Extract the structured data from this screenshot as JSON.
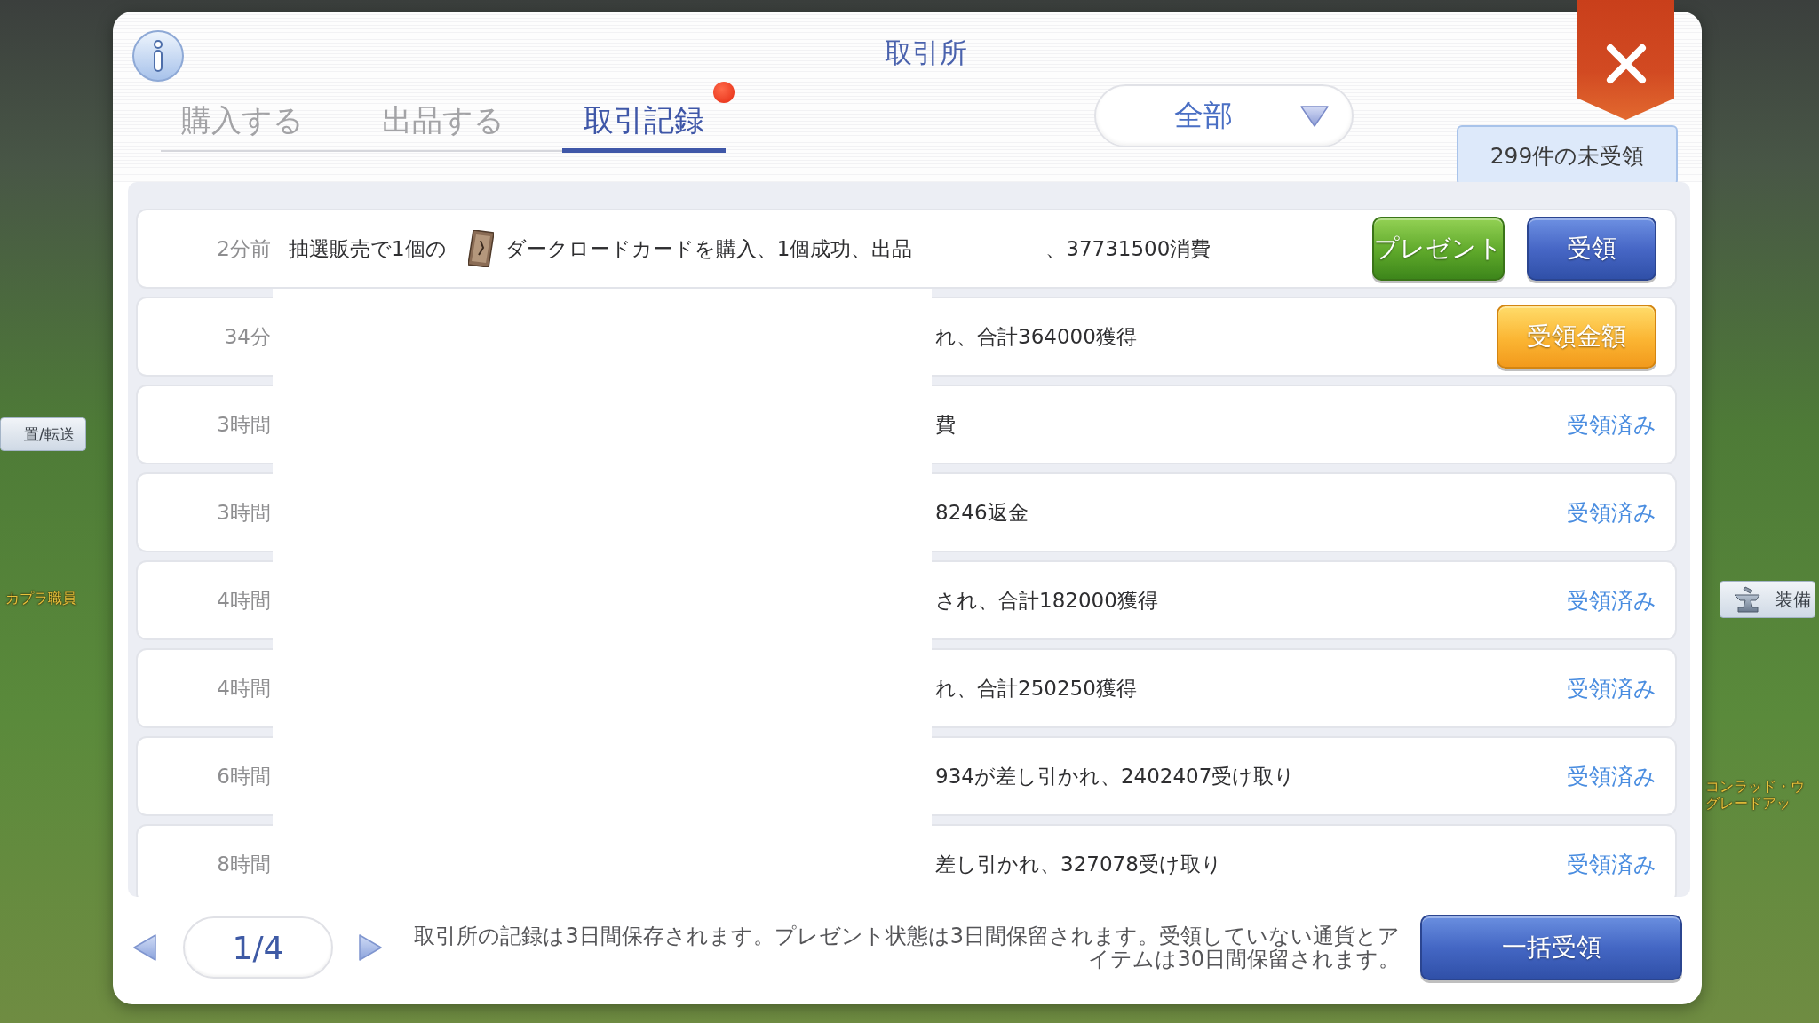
{
  "window": {
    "title": "取引所"
  },
  "tabs": [
    {
      "label": "購入する",
      "selected": false,
      "has_update": false
    },
    {
      "label": "出品する",
      "selected": false,
      "has_update": false
    },
    {
      "label": "取引記録",
      "selected": true,
      "has_update": true
    }
  ],
  "filter": {
    "value": "全部"
  },
  "unclaimed_badge": {
    "text": "299件の未受領"
  },
  "records": [
    {
      "time": "2分前",
      "segments": [
        {
          "kind": "text",
          "text": "抽選販売で1個の"
        },
        {
          "kind": "item_icon"
        },
        {
          "kind": "text",
          "text": "ダークロードカードを購入、1個成功、出品"
        },
        {
          "kind": "hidden"
        },
        {
          "kind": "text",
          "text": "、37731500消費"
        }
      ],
      "actions": [
        {
          "kind": "present",
          "label": "プレゼント"
        },
        {
          "kind": "claim",
          "label": "受領"
        }
      ]
    },
    {
      "time": "34分",
      "detail": "れ、合計364000獲得",
      "actions": [
        {
          "kind": "claim_amount",
          "label": "受領金額"
        }
      ]
    },
    {
      "time": "3時間",
      "detail": "費",
      "actions": [
        {
          "kind": "claimed",
          "label": "受領済み"
        }
      ]
    },
    {
      "time": "3時間",
      "detail": "8246返金",
      "actions": [
        {
          "kind": "claimed",
          "label": "受領済み"
        }
      ]
    },
    {
      "time": "4時間",
      "detail": "され、合計182000獲得",
      "actions": [
        {
          "kind": "claimed",
          "label": "受領済み"
        }
      ]
    },
    {
      "time": "4時間",
      "detail": "れ、合計250250獲得",
      "actions": [
        {
          "kind": "claimed",
          "label": "受領済み"
        }
      ]
    },
    {
      "time": "6時間",
      "detail": "934が差し引かれ、2402407受け取り",
      "actions": [
        {
          "kind": "claimed",
          "label": "受領済み"
        }
      ]
    },
    {
      "time": "8時間",
      "detail": "差し引かれ、327078受け取り",
      "actions": [
        {
          "kind": "claimed",
          "label": "受領済み"
        }
      ]
    }
  ],
  "pagination": {
    "page": "1/4"
  },
  "note": "取引所の記録は3日間保存されます。プレゼント状態は3日間保留されます。受領していない通貨とアイテムは30日間保留されます。",
  "claim_all_button": {
    "label": "一括受領"
  },
  "game_hud": {
    "buttons": [
      {
        "kind": "text",
        "label": "置/転送"
      },
      {
        "kind": "icon",
        "label": "装備"
      }
    ],
    "npc_labels": [
      {
        "lines": [
          "カプラ職員"
        ]
      },
      {
        "lines": [
          "コンラッド・ウ",
          "グレードアッ"
        ]
      }
    ]
  }
}
